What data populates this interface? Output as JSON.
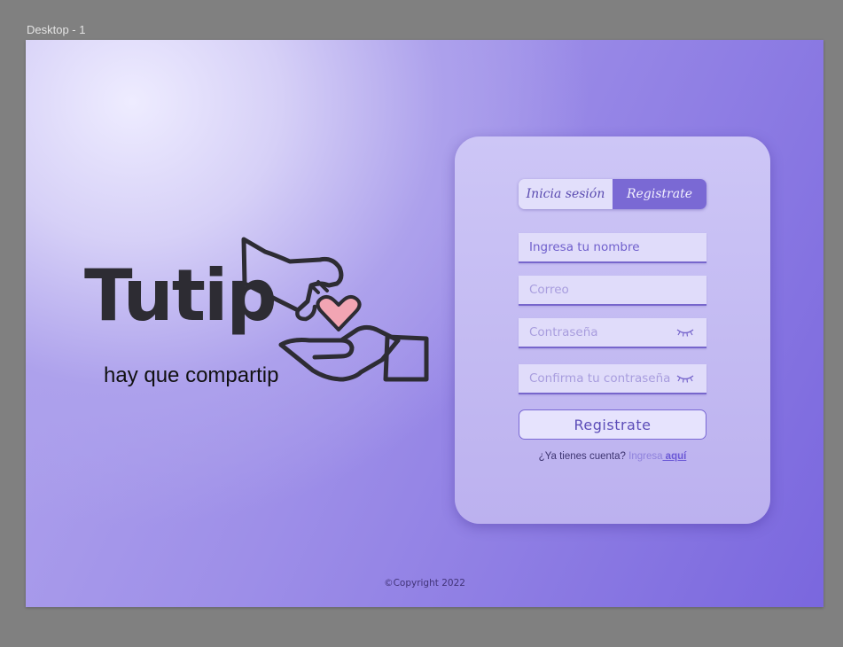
{
  "frame": {
    "label": "Desktop - 1"
  },
  "colors": {
    "accent": "#7a69d4",
    "heart": "#f2a5b3",
    "ink": "#2d2c33"
  },
  "brand": {
    "name": "Tutip",
    "tagline": "hay que compartip"
  },
  "tabs": [
    {
      "label": "Inicia sesión",
      "active": false
    },
    {
      "label": "Registrate",
      "active": true
    }
  ],
  "form": {
    "name_placeholder": "Ingresa tu nombre",
    "email_placeholder": "Correo",
    "password_placeholder": "Contraseña",
    "confirm_placeholder": "Confirma tu contraseña",
    "submit_label": "Registrate"
  },
  "login_prompt": {
    "question": "¿Ya tienes cuenta?",
    "action": "Ingresa",
    "link": " aquí"
  },
  "footer": {
    "copyright": "©Copyright 2022"
  },
  "icons": {
    "password_toggle": "closed-eye-icon",
    "logo_art": "hands-heart-icon"
  }
}
